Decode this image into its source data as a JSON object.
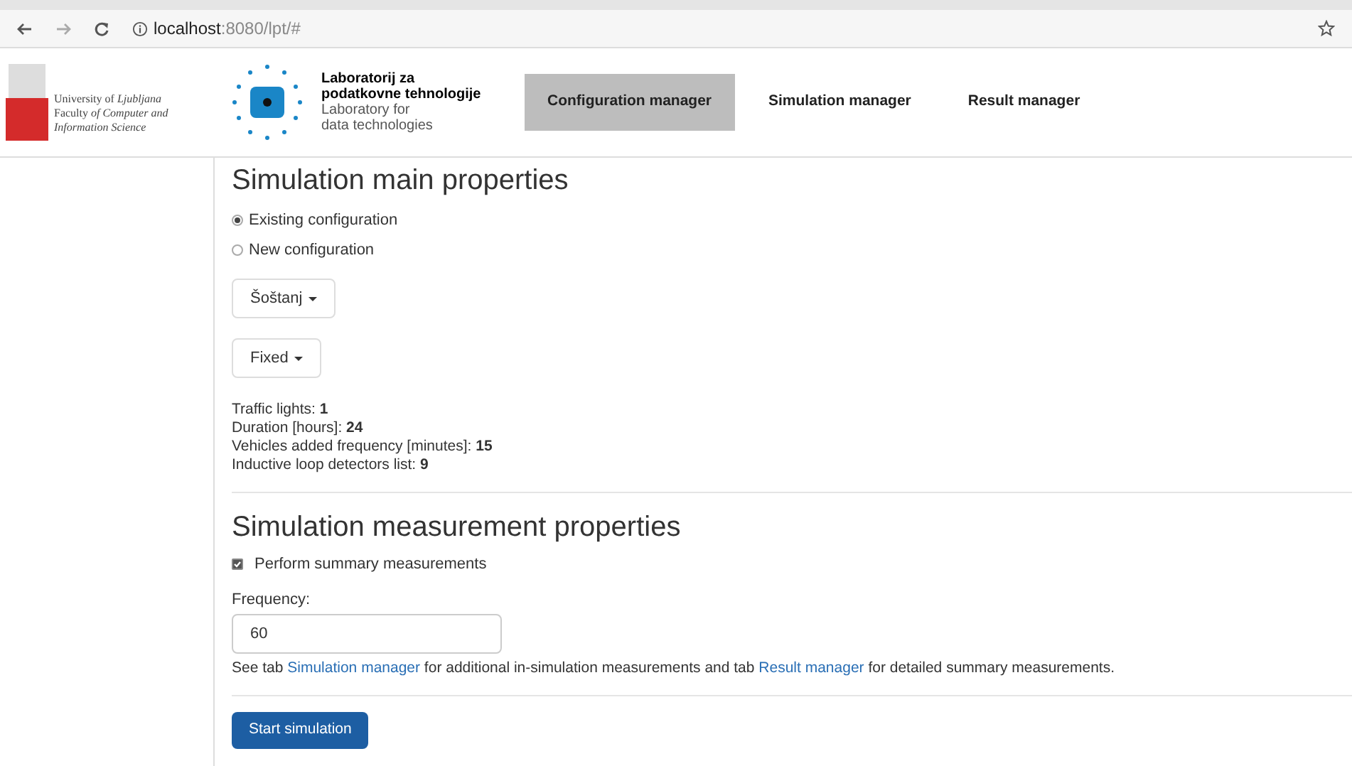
{
  "browser": {
    "url_host": "localhost",
    "url_path": ":8080/lpt/#"
  },
  "header": {
    "university": [
      {
        "text": "University of *Ljubljana*"
      },
      {
        "text": "Faculty *of Computer and*"
      },
      {
        "text": "*Information Science*"
      }
    ],
    "lab_title": [
      "Laboratorij za",
      "podatkovne tehnologije"
    ],
    "lab_subtitle": [
      "Laboratory for",
      "data technologies"
    ],
    "tabs": [
      {
        "label": "Configuration manager",
        "selected": true
      },
      {
        "label": "Simulation manager",
        "selected": false
      },
      {
        "label": "Result manager",
        "selected": false
      }
    ]
  },
  "main": {
    "title": "Simulation main properties",
    "radios": [
      {
        "label": "Existing configuration",
        "selected": true
      },
      {
        "label": "New configuration",
        "selected": false
      }
    ],
    "dropdowns": [
      "Šoštanj",
      "Fixed"
    ],
    "facts": [
      {
        "label": "Traffic lights:",
        "value": "1"
      },
      {
        "label": "Duration [hours]:",
        "value": "24"
      },
      {
        "label": "Vehicles added frequency [minutes]:",
        "value": "15"
      },
      {
        "label": "Inductive loop detectors list:",
        "value": "9"
      }
    ]
  },
  "measurement": {
    "title": "Simulation measurement properties",
    "checkbox": {
      "label": "Perform summary measurements",
      "checked": true
    },
    "frequency_label": "Frequency:",
    "frequency_value": "60",
    "note": [
      {
        "text": "See tab ",
        "kind": "text"
      },
      {
        "text": "Simulation manager",
        "kind": "link"
      },
      {
        "text": " for additional in-simulation measurements and tab ",
        "kind": "text"
      },
      {
        "text": "Result manager",
        "kind": "link"
      },
      {
        "text": " for detailed summary measurements.",
        "kind": "text"
      }
    ]
  },
  "start_button": "Start simulation"
}
